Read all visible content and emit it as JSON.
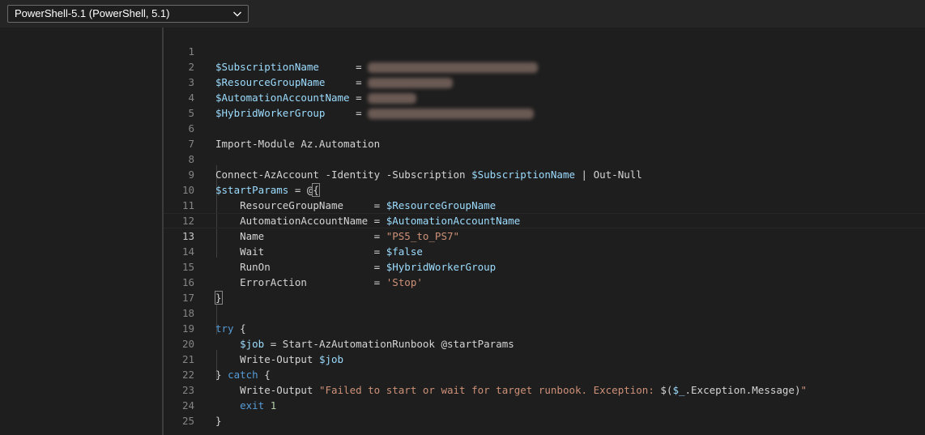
{
  "toolbar": {
    "runtime_selector": {
      "value": "PowerShell-5.1 (PowerShell, 5.1)",
      "icon": "chevron-down-icon"
    }
  },
  "editor": {
    "language": "powershell",
    "active_line": 13,
    "line_numbers": [
      "1",
      "2",
      "3",
      "4",
      "5",
      "6",
      "7",
      "8",
      "9",
      "10",
      "11",
      "12",
      "13",
      "14",
      "15",
      "16",
      "17",
      "18",
      "19",
      "20",
      "21",
      "22",
      "23",
      "24",
      "25"
    ],
    "text": {
      "l1_var": "$SubscriptionName",
      "l1_op": "      =",
      "l2_var": "$ResourceGroupName",
      "l2_op": "     =",
      "l3_var": "$AutomationAccountName",
      "l3_op": " =",
      "l4_var": "$HybridWorkerGroup",
      "l4_op": "     =",
      "l6": "Import-Module Az.Automation",
      "l8_a": "Connect-AzAccount -Identity -Subscription ",
      "l8_var": "$SubscriptionName",
      "l8_b": " | Out-Null",
      "l9_var": "$startParams",
      "l9_op": " = @",
      "l9_brace": "{",
      "l10_key": "    ResourceGroupName     = ",
      "l10_val": "$ResourceGroupName",
      "l11_key": "    AutomationAccountName = ",
      "l11_val": "$AutomationAccountName",
      "l12_key": "    Name                  = ",
      "l12_val": "\"PS5_to_PS7\"",
      "l13_key": "    Wait                  = ",
      "l13_val": "$false",
      "l14_key": "    RunOn                 = ",
      "l14_val": "$HybridWorkerGroup",
      "l15_key": "    ErrorAction           = ",
      "l15_val": "'Stop'",
      "l16_brace": "}",
      "l18_kw": "try",
      "l18_rest": " {",
      "l19_indent": "    ",
      "l19_var": "$job",
      "l19_rest": " = Start-AzAutomationRunbook @startParams",
      "l20_a": "    Write-Output ",
      "l20_var": "$job",
      "l21_a": "} ",
      "l21_kw": "catch",
      "l21_b": " {",
      "l22_a": "    Write-Output ",
      "l22_str1": "\"Failed to start or wait for target runbook. Exception: ",
      "l22_sub1": "$(",
      "l22_var": "$_",
      "l22_sub2": ".Exception.Message)",
      "l22_str2": "\"",
      "l23_indent": "    ",
      "l23_kw": "exit",
      "l23_sp": " ",
      "l23_num": "1",
      "l24": "}"
    },
    "redacted_values": [
      "value-line-1",
      "value-line-2",
      "value-line-3",
      "value-line-4"
    ]
  },
  "colors": {
    "variable": "#9cdcfe",
    "string": "#ce9178",
    "keyword": "#569cd6",
    "number": "#b5cea8",
    "text": "#d4d4d4",
    "line_number": "#858585",
    "background": "#1e1e1e"
  }
}
